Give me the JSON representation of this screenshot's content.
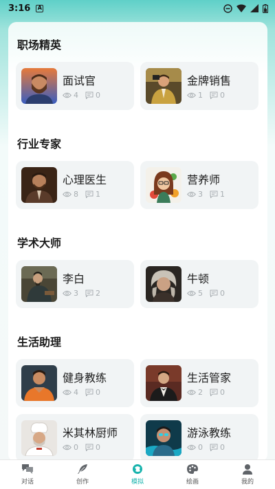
{
  "status_bar": {
    "time": "3:16",
    "notification_letter": "A"
  },
  "sections": [
    {
      "title": "职场精英",
      "items": [
        {
          "name": "面试官",
          "views": "4",
          "comments": "0",
          "avatar": "interviewer-avatar"
        },
        {
          "name": "金牌销售",
          "views": "1",
          "comments": "0",
          "avatar": "salesman-avatar"
        }
      ]
    },
    {
      "title": "行业专家",
      "items": [
        {
          "name": "心理医生",
          "views": "8",
          "comments": "1",
          "avatar": "psychologist-avatar"
        },
        {
          "name": "营养师",
          "views": "3",
          "comments": "1",
          "avatar": "nutritionist-avatar"
        }
      ]
    },
    {
      "title": "学术大师",
      "items": [
        {
          "name": "李白",
          "views": "3",
          "comments": "2",
          "avatar": "li-bai-avatar"
        },
        {
          "name": "牛顿",
          "views": "5",
          "comments": "0",
          "avatar": "newton-avatar"
        }
      ]
    },
    {
      "title": "生活助理",
      "items": [
        {
          "name": "健身教练",
          "views": "4",
          "comments": "0",
          "avatar": "fitness-coach-avatar"
        },
        {
          "name": "生活管家",
          "views": "2",
          "comments": "0",
          "avatar": "butler-avatar"
        },
        {
          "name": "米其林厨师",
          "views": "0",
          "comments": "0",
          "avatar": "chef-avatar"
        },
        {
          "name": "游泳教练",
          "views": "0",
          "comments": "0",
          "avatar": "swim-coach-avatar"
        }
      ]
    }
  ],
  "nav": [
    {
      "label": "对话",
      "icon": "chat-icon",
      "active": false
    },
    {
      "label": "创作",
      "icon": "feather-icon",
      "active": false
    },
    {
      "label": "模拟",
      "icon": "simulate-icon",
      "active": true
    },
    {
      "label": "绘画",
      "icon": "palette-icon",
      "active": false
    },
    {
      "label": "我的",
      "icon": "user-icon",
      "active": false
    }
  ],
  "colors": {
    "accent": "#18b3ad",
    "card_bg": "#f1f4f5",
    "text_muted": "#a7adb1"
  }
}
